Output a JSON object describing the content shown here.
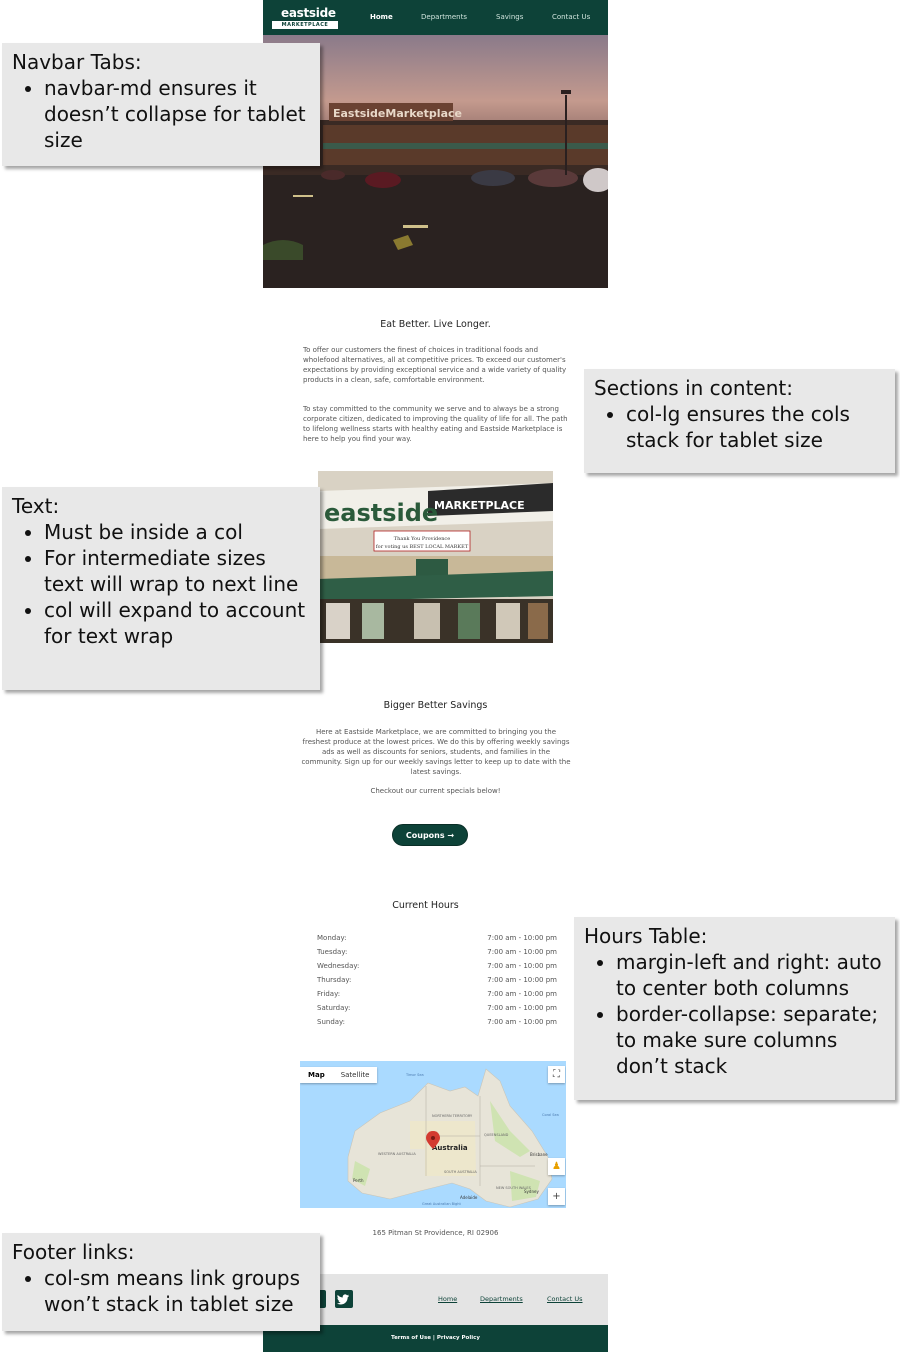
{
  "site": {
    "logo": {
      "top": "eastside",
      "bottom": "MARKETPLACE"
    },
    "nav": [
      {
        "label": "Home",
        "active": true
      },
      {
        "label": "Departments",
        "active": false
      },
      {
        "label": "Savings",
        "active": false
      },
      {
        "label": "Contact Us",
        "active": false
      }
    ],
    "hero_sign": "EastsideMarketplace",
    "section1": {
      "heading": "Eat Better. Live Longer.",
      "p1": "To offer our customers the finest of choices in traditional foods and wholefood alternatives, all at competitive prices. To exceed our customer's expectations by providing exceptional service and a wide variety of quality products in a clean, safe, comfortable environment.",
      "p2": "To stay committed to the community we serve and to always be a strong corporate citizen, dedicated to improving the quality of life for all. The path to lifelong wellness starts with healthy eating and Eastside Marketplace is here to help you find your way."
    },
    "store_sign": {
      "left": "eastside",
      "right": "MARKETPLACE",
      "banner_line1": "Thank You Providence",
      "banner_line2": "for voting us BEST LOCAL MARKET"
    },
    "section2": {
      "heading": "Bigger Better Savings",
      "p1": "Here at Eastside Marketplace, we are committed to bringing you the freshest produce at the lowest prices. We do this by offering weekly savings ads as well as discounts for seniors, students, and families in the community. Sign up for our weekly savings letter to keep up to date with the latest savings.",
      "p2": "Checkout our current specials below!",
      "button": "Coupons →"
    },
    "hours": {
      "heading": "Current Hours",
      "rows": [
        {
          "day": "Monday:",
          "time": "7:00 am - 10:00 pm"
        },
        {
          "day": "Tuesday:",
          "time": "7:00 am - 10:00 pm"
        },
        {
          "day": "Wednesday:",
          "time": "7:00 am - 10:00 pm"
        },
        {
          "day": "Thursday:",
          "time": "7:00 am - 10:00 pm"
        },
        {
          "day": "Friday:",
          "time": "7:00 am - 10:00 pm"
        },
        {
          "day": "Saturday:",
          "time": "7:00 am - 10:00 pm"
        },
        {
          "day": "Sunday:",
          "time": "7:00 am - 10:00 pm"
        }
      ]
    },
    "map": {
      "btn_map": "Map",
      "btn_satellite": "Satellite",
      "label_country": "Australia",
      "label_nt": "NORTHERN TERRITORY",
      "label_qld": "QUEENSLAND",
      "label_wa": "WESTERN AUSTRALIA",
      "label_sa": "SOUTH AUSTRALIA",
      "label_nsw": "NEW SOUTH WALES",
      "label_brisbane": "Brisbane",
      "label_sydney": "Sydney",
      "label_perth": "Perth",
      "label_adelaide": "Adelaide",
      "label_bight": "Great Australian Bight",
      "label_coral": "Coral Sea",
      "label_timor": "Timor Sea"
    },
    "address": "165 Pitman St Providence, RI 02906",
    "footer_links": [
      "Home",
      "Departments",
      "Contact Us"
    ],
    "footer_bottom": "Terms of Use | Privacy Policy"
  },
  "notes": {
    "navbar": {
      "title": "Navbar Tabs:",
      "bullets": [
        "navbar-md ensures it doesn’t collapse for tablet size"
      ]
    },
    "sections": {
      "title": "Sections in content:",
      "bullets": [
        "col-lg ensures the cols stack for tablet size"
      ]
    },
    "text": {
      "title": "Text:",
      "bullets": [
        "Must be inside a col",
        "For intermediate sizes text will wrap to next line",
        "col will expand to account for text wrap"
      ]
    },
    "hours": {
      "title": "Hours Table:",
      "bullets": [
        "margin-left and right: auto to center both columns",
        "border-collapse: separate; to make sure columns don’t stack"
      ]
    },
    "footer": {
      "title": "Footer links:",
      "bullets": [
        "col-sm means link groups won’t stack in tablet size"
      ]
    }
  },
  "colors": {
    "brand_green": "#0d4238",
    "note_bg": "#e8e8e8"
  }
}
